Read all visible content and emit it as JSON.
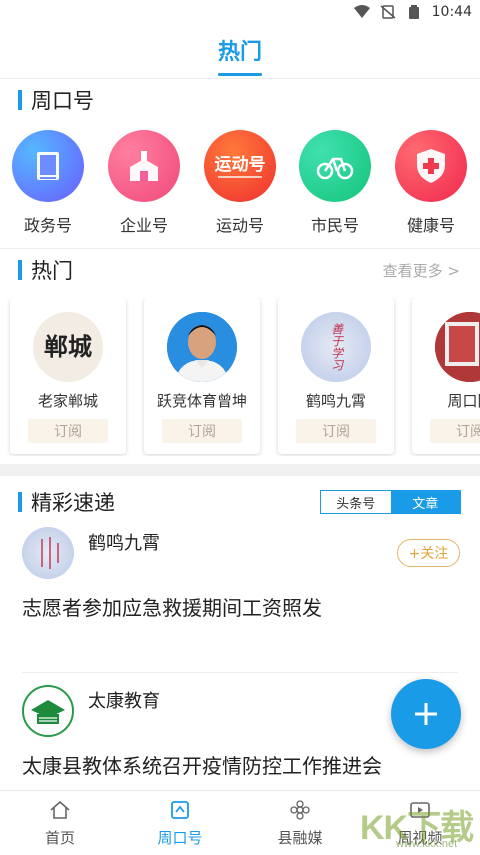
{
  "status_bar": {
    "time": "10:44"
  },
  "header": {
    "title": "热门"
  },
  "sections": {
    "zhoukou": {
      "title": "周口号"
    },
    "hot": {
      "title": "热门",
      "more": "查看更多 >"
    },
    "feed": {
      "title": "精彩速递"
    }
  },
  "categories": [
    {
      "label": "政务号",
      "icon": "book-icon",
      "color_from": "#3aa0ff",
      "color_to": "#7b5cff"
    },
    {
      "label": "企业号",
      "icon": "building-icon",
      "color_from": "#ff5c8a",
      "color_to": "#ff8a5c"
    },
    {
      "label": "运动号",
      "icon": "sport-logo-icon",
      "badge_text": "运动号",
      "color_from": "#ff4a3a",
      "color_to": "#ff9a2a"
    },
    {
      "label": "市民号",
      "icon": "bicycle-icon",
      "color_from": "#1fd19a",
      "color_to": "#28c86e"
    },
    {
      "label": "健康号",
      "icon": "health-shield-icon",
      "color_from": "#ff4a5a",
      "color_to": "#ff2e6e"
    }
  ],
  "hot_cards": [
    {
      "name": "老家郸城",
      "subscribe": "订阅",
      "avatar_text": "郸城"
    },
    {
      "name": "跃竞体育曾坤",
      "subscribe": "订阅"
    },
    {
      "name": "鹤鸣九霄",
      "subscribe": "订阅",
      "avatar_text": "善于学习"
    },
    {
      "name": "周口同",
      "subscribe": "订阅"
    }
  ],
  "feed_tabs": {
    "left": "头条号",
    "right": "文章"
  },
  "posts": [
    {
      "author": "鹤鸣九霄",
      "follow": "+关注",
      "title": "志愿者参加应急救援期间工资照发"
    },
    {
      "author": "太康教育",
      "title": "太康县教体系统召开疫情防控工作推进会"
    }
  ],
  "bottom_nav": [
    {
      "label": "首页",
      "icon": "home-icon"
    },
    {
      "label": "周口号",
      "icon": "zhoukou-icon",
      "active": true
    },
    {
      "label": "县融媒",
      "icon": "flower-icon"
    },
    {
      "label": "周视频",
      "icon": "video-icon"
    }
  ],
  "watermark": {
    "brand": "KK下载",
    "url": "www.kkx.net"
  },
  "colors": {
    "accent": "#1a9be8",
    "follow": "#e0a53c"
  }
}
